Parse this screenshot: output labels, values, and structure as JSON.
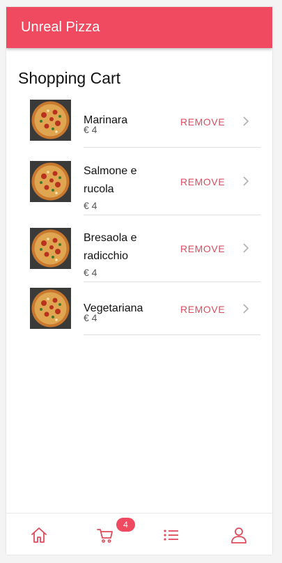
{
  "app": {
    "title": "Unreal Pizza",
    "accent_color": "#ef4a5f"
  },
  "page": {
    "heading": "Shopping Cart"
  },
  "cart": {
    "remove_label": "REMOVE",
    "items": [
      {
        "name": "Marinara",
        "price": "€ 4"
      },
      {
        "name": "Salmone e rucola",
        "price": "€ 4"
      },
      {
        "name": "Bresaola e radicchio",
        "price": "€ 4"
      },
      {
        "name": "Vegetariana",
        "price": "€ 4"
      }
    ]
  },
  "tabbar": {
    "tabs": [
      {
        "icon": "home-icon"
      },
      {
        "icon": "cart-icon"
      },
      {
        "icon": "list-icon"
      },
      {
        "icon": "user-icon"
      }
    ],
    "cart_badge": "4"
  }
}
